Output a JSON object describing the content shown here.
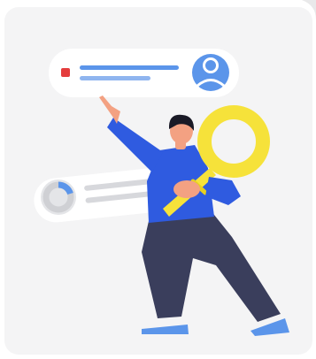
{
  "illustration": {
    "subject": "person-with-magnifying-glass",
    "icons": [
      "user-avatar-icon",
      "donut-chart-icon",
      "magnifying-glass-icon",
      "status-square-icon"
    ],
    "colors": {
      "background": "#f4f4f5",
      "card_white": "#ffffff",
      "accent_blue": "#5b95ea",
      "light_blue": "#8fb5ef",
      "red_marker": "#e43d3d",
      "yellow": "#f6e23a",
      "shirt": "#2f5be0",
      "pants": "#3a3e5c",
      "skin": "#f3a182",
      "hair": "#1a1a26",
      "shoes": "#5b95ea",
      "grey_lines": "#d7d8dc"
    }
  }
}
